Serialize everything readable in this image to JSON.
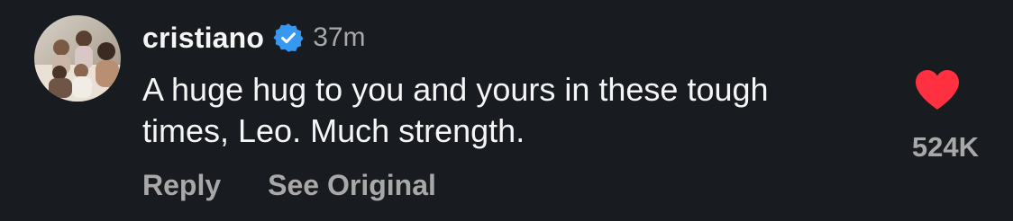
{
  "comment": {
    "username": "cristiano",
    "verified": true,
    "timestamp": "37m",
    "text": "A huge hug to you and yours in these tough times, Leo. Much strength.",
    "like_count": "524K",
    "liked": true,
    "actions": {
      "reply_label": "Reply",
      "see_original_label": "See Original"
    }
  },
  "icons": {
    "avatar": "profile-photo-icon",
    "verified": "verified-badge-icon",
    "like": "heart-filled-icon"
  },
  "colors": {
    "background": "#181b1f",
    "primary_text": "#f5f5f5",
    "secondary_text": "#a8a8a8",
    "verified_blue": "#3897f0",
    "like_red": "#ff3040"
  }
}
